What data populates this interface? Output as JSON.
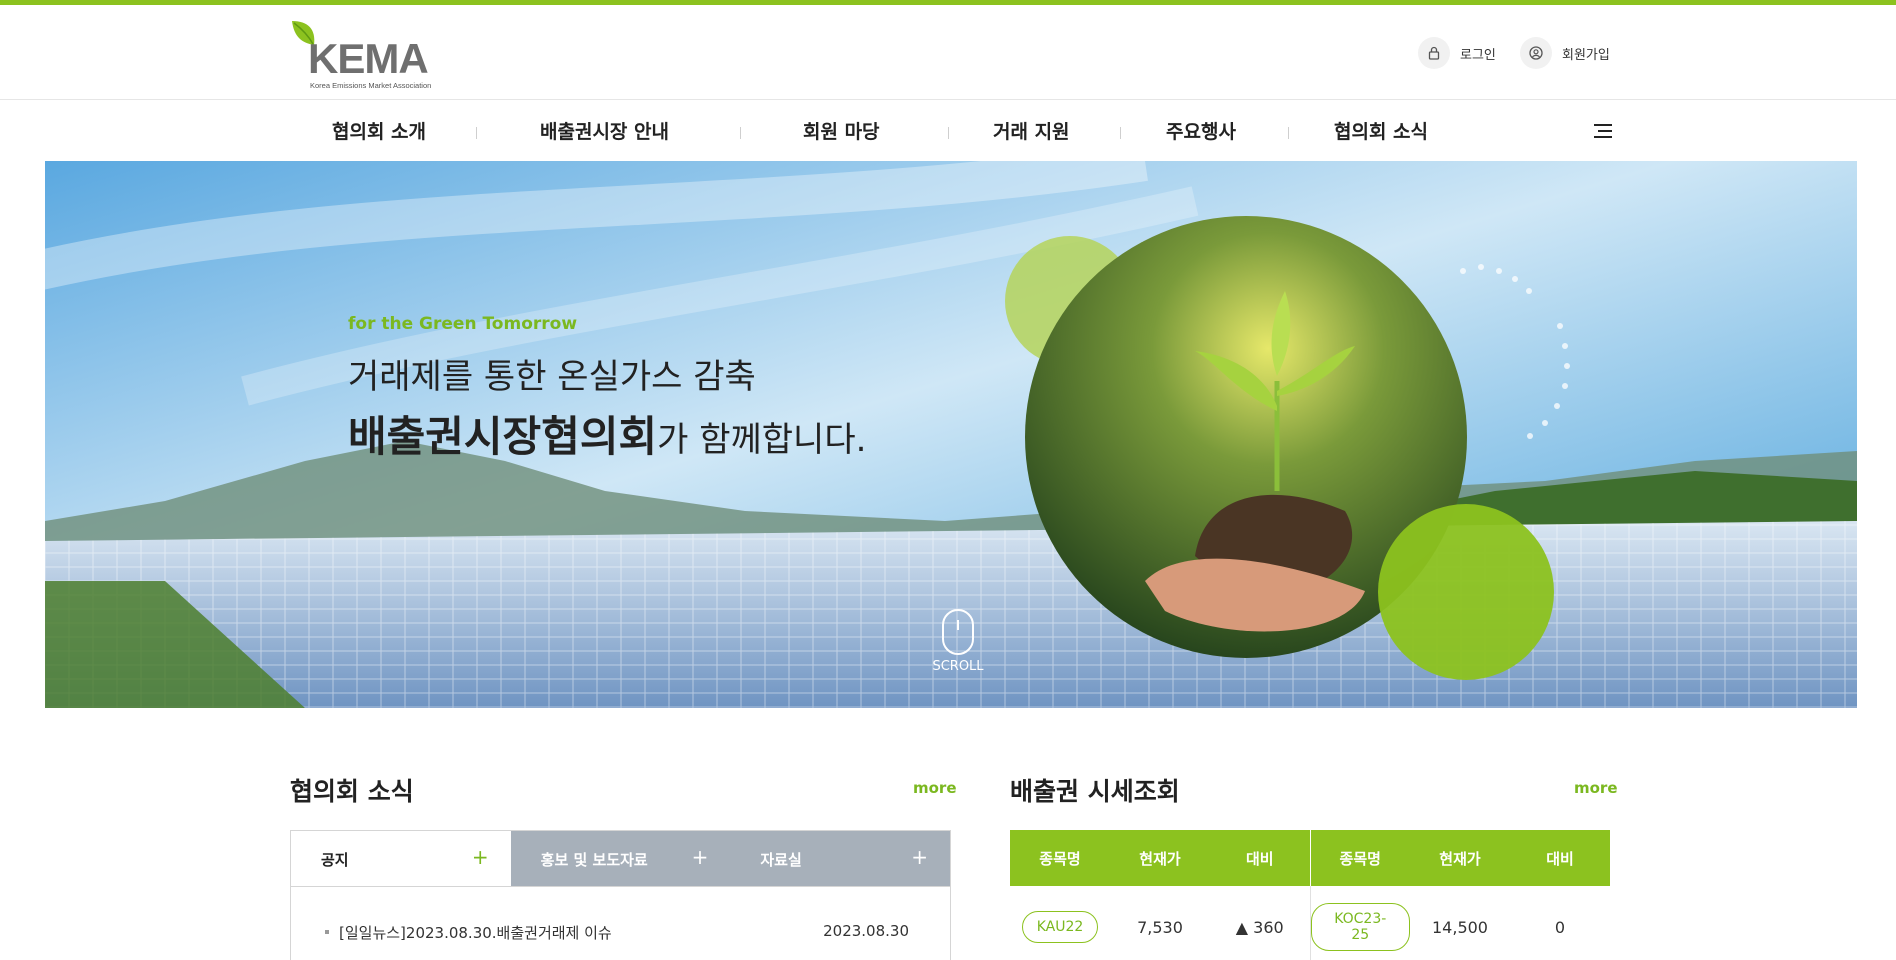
{
  "header": {
    "logo_text": "KEMA",
    "logo_sub": "Korea Emissions Market Association",
    "login_label": "로그인",
    "join_label": "회원가입"
  },
  "gnb": {
    "items": [
      "협의회 소개",
      "배출권시장 안내",
      "회원 마당",
      "거래 지원",
      "주요행사",
      "협의회 소식"
    ]
  },
  "hero": {
    "sub": "for the Green Tomorrow",
    "line1": "거래제를 통한 온실가스 감축",
    "line2_bold": "배출권시장협의회",
    "line2_rest": "가 함께합니다.",
    "scroll_label": "SCROLL"
  },
  "news": {
    "title": "협의회 소식",
    "more": "more",
    "tabs": [
      "공지",
      "홍보 및 보도자료",
      "자료실"
    ],
    "items": [
      {
        "title": "[일일뉴스]2023.08.30.배출권거래제 이슈",
        "date": "2023.08.30"
      }
    ]
  },
  "price": {
    "title": "배출권 시세조회",
    "more": "more",
    "headers": [
      "종목명",
      "현재가",
      "대비",
      "종목명",
      "현재가",
      "대비"
    ],
    "rows": [
      {
        "name1": "KAU22",
        "price1": "7,530",
        "change1": "▲ 360",
        "name2": "KOC23-25",
        "price2": "14,500",
        "change2": "0"
      }
    ]
  },
  "colors": {
    "brand_green": "#8cc21f",
    "tab_gray": "#a7b0ba",
    "up_red": "#e5260e"
  }
}
